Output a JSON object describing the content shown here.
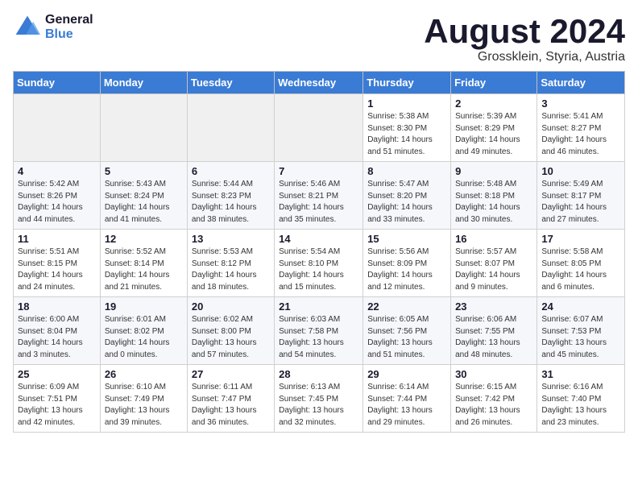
{
  "header": {
    "logo_line1": "General",
    "logo_line2": "Blue",
    "month": "August 2024",
    "location": "Grossklein, Styria, Austria"
  },
  "days_of_week": [
    "Sunday",
    "Monday",
    "Tuesday",
    "Wednesday",
    "Thursday",
    "Friday",
    "Saturday"
  ],
  "weeks": [
    [
      {
        "num": "",
        "info": ""
      },
      {
        "num": "",
        "info": ""
      },
      {
        "num": "",
        "info": ""
      },
      {
        "num": "",
        "info": ""
      },
      {
        "num": "1",
        "info": "Sunrise: 5:38 AM\nSunset: 8:30 PM\nDaylight: 14 hours\nand 51 minutes."
      },
      {
        "num": "2",
        "info": "Sunrise: 5:39 AM\nSunset: 8:29 PM\nDaylight: 14 hours\nand 49 minutes."
      },
      {
        "num": "3",
        "info": "Sunrise: 5:41 AM\nSunset: 8:27 PM\nDaylight: 14 hours\nand 46 minutes."
      }
    ],
    [
      {
        "num": "4",
        "info": "Sunrise: 5:42 AM\nSunset: 8:26 PM\nDaylight: 14 hours\nand 44 minutes."
      },
      {
        "num": "5",
        "info": "Sunrise: 5:43 AM\nSunset: 8:24 PM\nDaylight: 14 hours\nand 41 minutes."
      },
      {
        "num": "6",
        "info": "Sunrise: 5:44 AM\nSunset: 8:23 PM\nDaylight: 14 hours\nand 38 minutes."
      },
      {
        "num": "7",
        "info": "Sunrise: 5:46 AM\nSunset: 8:21 PM\nDaylight: 14 hours\nand 35 minutes."
      },
      {
        "num": "8",
        "info": "Sunrise: 5:47 AM\nSunset: 8:20 PM\nDaylight: 14 hours\nand 33 minutes."
      },
      {
        "num": "9",
        "info": "Sunrise: 5:48 AM\nSunset: 8:18 PM\nDaylight: 14 hours\nand 30 minutes."
      },
      {
        "num": "10",
        "info": "Sunrise: 5:49 AM\nSunset: 8:17 PM\nDaylight: 14 hours\nand 27 minutes."
      }
    ],
    [
      {
        "num": "11",
        "info": "Sunrise: 5:51 AM\nSunset: 8:15 PM\nDaylight: 14 hours\nand 24 minutes."
      },
      {
        "num": "12",
        "info": "Sunrise: 5:52 AM\nSunset: 8:14 PM\nDaylight: 14 hours\nand 21 minutes."
      },
      {
        "num": "13",
        "info": "Sunrise: 5:53 AM\nSunset: 8:12 PM\nDaylight: 14 hours\nand 18 minutes."
      },
      {
        "num": "14",
        "info": "Sunrise: 5:54 AM\nSunset: 8:10 PM\nDaylight: 14 hours\nand 15 minutes."
      },
      {
        "num": "15",
        "info": "Sunrise: 5:56 AM\nSunset: 8:09 PM\nDaylight: 14 hours\nand 12 minutes."
      },
      {
        "num": "16",
        "info": "Sunrise: 5:57 AM\nSunset: 8:07 PM\nDaylight: 14 hours\nand 9 minutes."
      },
      {
        "num": "17",
        "info": "Sunrise: 5:58 AM\nSunset: 8:05 PM\nDaylight: 14 hours\nand 6 minutes."
      }
    ],
    [
      {
        "num": "18",
        "info": "Sunrise: 6:00 AM\nSunset: 8:04 PM\nDaylight: 14 hours\nand 3 minutes."
      },
      {
        "num": "19",
        "info": "Sunrise: 6:01 AM\nSunset: 8:02 PM\nDaylight: 14 hours\nand 0 minutes."
      },
      {
        "num": "20",
        "info": "Sunrise: 6:02 AM\nSunset: 8:00 PM\nDaylight: 13 hours\nand 57 minutes."
      },
      {
        "num": "21",
        "info": "Sunrise: 6:03 AM\nSunset: 7:58 PM\nDaylight: 13 hours\nand 54 minutes."
      },
      {
        "num": "22",
        "info": "Sunrise: 6:05 AM\nSunset: 7:56 PM\nDaylight: 13 hours\nand 51 minutes."
      },
      {
        "num": "23",
        "info": "Sunrise: 6:06 AM\nSunset: 7:55 PM\nDaylight: 13 hours\nand 48 minutes."
      },
      {
        "num": "24",
        "info": "Sunrise: 6:07 AM\nSunset: 7:53 PM\nDaylight: 13 hours\nand 45 minutes."
      }
    ],
    [
      {
        "num": "25",
        "info": "Sunrise: 6:09 AM\nSunset: 7:51 PM\nDaylight: 13 hours\nand 42 minutes."
      },
      {
        "num": "26",
        "info": "Sunrise: 6:10 AM\nSunset: 7:49 PM\nDaylight: 13 hours\nand 39 minutes."
      },
      {
        "num": "27",
        "info": "Sunrise: 6:11 AM\nSunset: 7:47 PM\nDaylight: 13 hours\nand 36 minutes."
      },
      {
        "num": "28",
        "info": "Sunrise: 6:13 AM\nSunset: 7:45 PM\nDaylight: 13 hours\nand 32 minutes."
      },
      {
        "num": "29",
        "info": "Sunrise: 6:14 AM\nSunset: 7:44 PM\nDaylight: 13 hours\nand 29 minutes."
      },
      {
        "num": "30",
        "info": "Sunrise: 6:15 AM\nSunset: 7:42 PM\nDaylight: 13 hours\nand 26 minutes."
      },
      {
        "num": "31",
        "info": "Sunrise: 6:16 AM\nSunset: 7:40 PM\nDaylight: 13 hours\nand 23 minutes."
      }
    ]
  ]
}
